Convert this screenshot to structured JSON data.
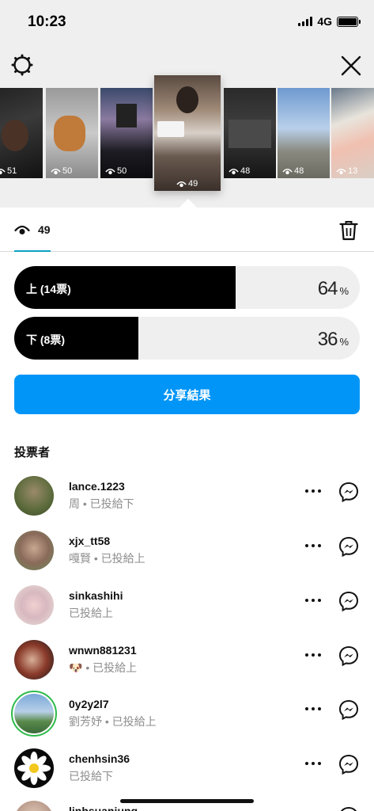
{
  "status": {
    "time": "10:23",
    "network": "4G"
  },
  "stories": [
    {
      "views": "51"
    },
    {
      "views": "50"
    },
    {
      "views": "50"
    },
    {
      "views": "49",
      "selected": true
    },
    {
      "views": "48"
    },
    {
      "views": "48"
    },
    {
      "views": "13"
    }
  ],
  "tab": {
    "views": "49"
  },
  "poll": {
    "options": [
      {
        "label": "上 (14票)",
        "percent": 64,
        "percent_text": "64",
        "unit": "%"
      },
      {
        "label": "下 (8票)",
        "percent": 36,
        "percent_text": "36",
        "unit": "%"
      }
    ]
  },
  "share_label": "分享結果",
  "voters_title": "投票者",
  "voters": [
    {
      "name": "lance.1223",
      "sub": "周 • 已投給下"
    },
    {
      "name": "xjx_tt58",
      "sub": "嘎賢 • 已投給上"
    },
    {
      "name": "sinkashihi",
      "sub": "已投給上"
    },
    {
      "name": "wnwn881231",
      "sub": "🐶 • 已投給上"
    },
    {
      "name": "0y2y2l7",
      "sub": "劉芳妤 • 已投給上",
      "ring": true
    },
    {
      "name": "chenhsin36",
      "sub": "已投給下"
    },
    {
      "name": "linhsuanjung",
      "sub": ""
    }
  ],
  "colors": {
    "accent": "#0095f6",
    "bar_fill": "#000000",
    "bar_bg": "#efefef",
    "story_ring": "#2dbb4a"
  }
}
